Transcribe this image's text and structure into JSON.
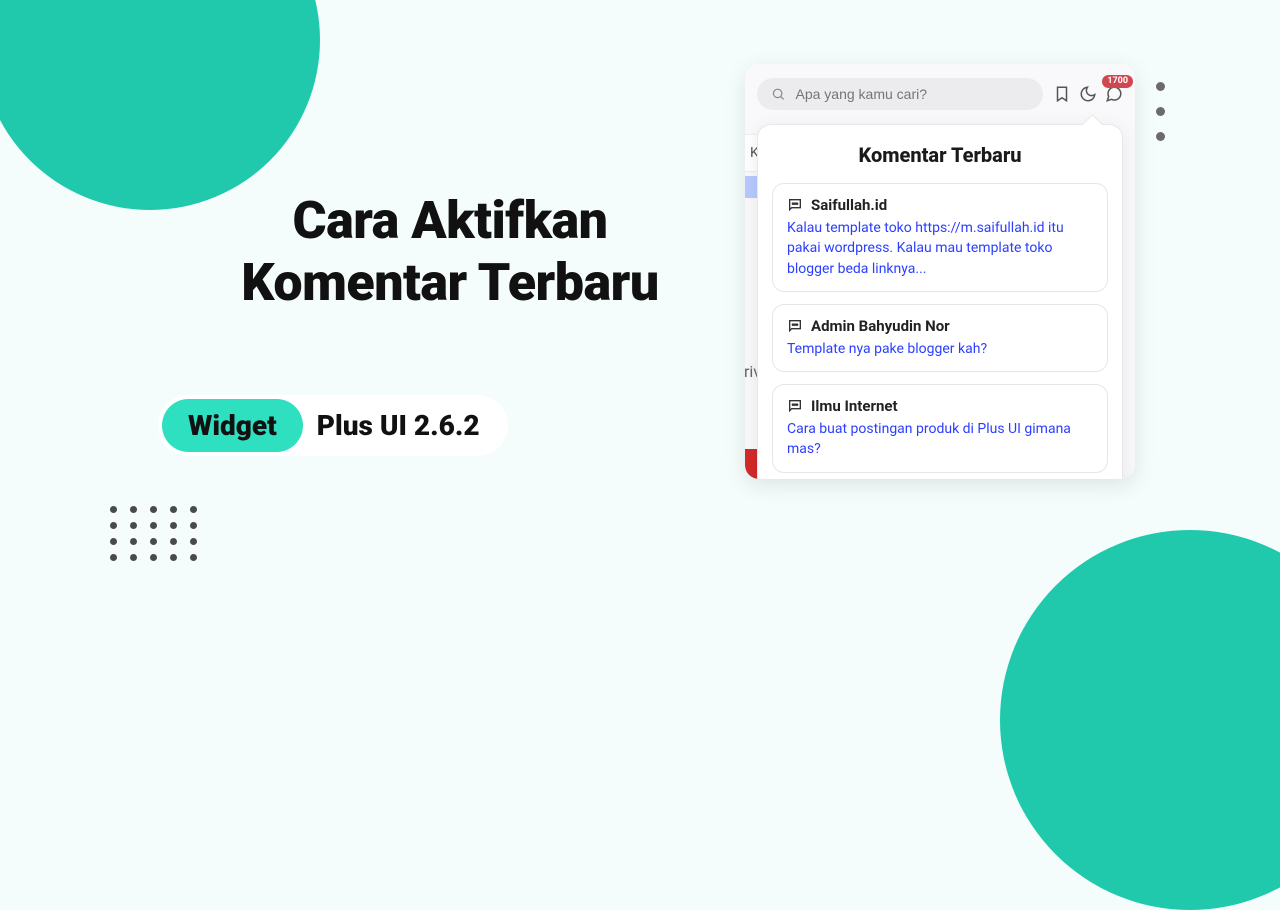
{
  "colors": {
    "accent": "#20c9ac",
    "link": "#2b3eff",
    "badge": "#d24650",
    "redBlock": "#d22a2a"
  },
  "heading": {
    "line1": "Cara Aktifkan",
    "line2": "Komentar Terbaru"
  },
  "pill": {
    "badge": "Widget",
    "text": "Plus UI 2.6.2"
  },
  "widget": {
    "search_placeholder": "Apa yang kamu cari?",
    "badge_count": "1700",
    "ke_label": "Ke",
    "priv_label": "priva",
    "dropdown_title": "Komentar Terbaru",
    "comments": [
      {
        "author": "Saifullah.id",
        "body": "Kalau template toko https://m.saifullah.id itu pakai wordpress. Kalau mau template toko blogger beda linknya..."
      },
      {
        "author": "Admin Bahyudin Nor",
        "body": "Template nya pake blogger kah?"
      },
      {
        "author": "Ilmu Internet",
        "body": "Cara buat postingan produk di Plus UI gimana mas?"
      }
    ]
  }
}
